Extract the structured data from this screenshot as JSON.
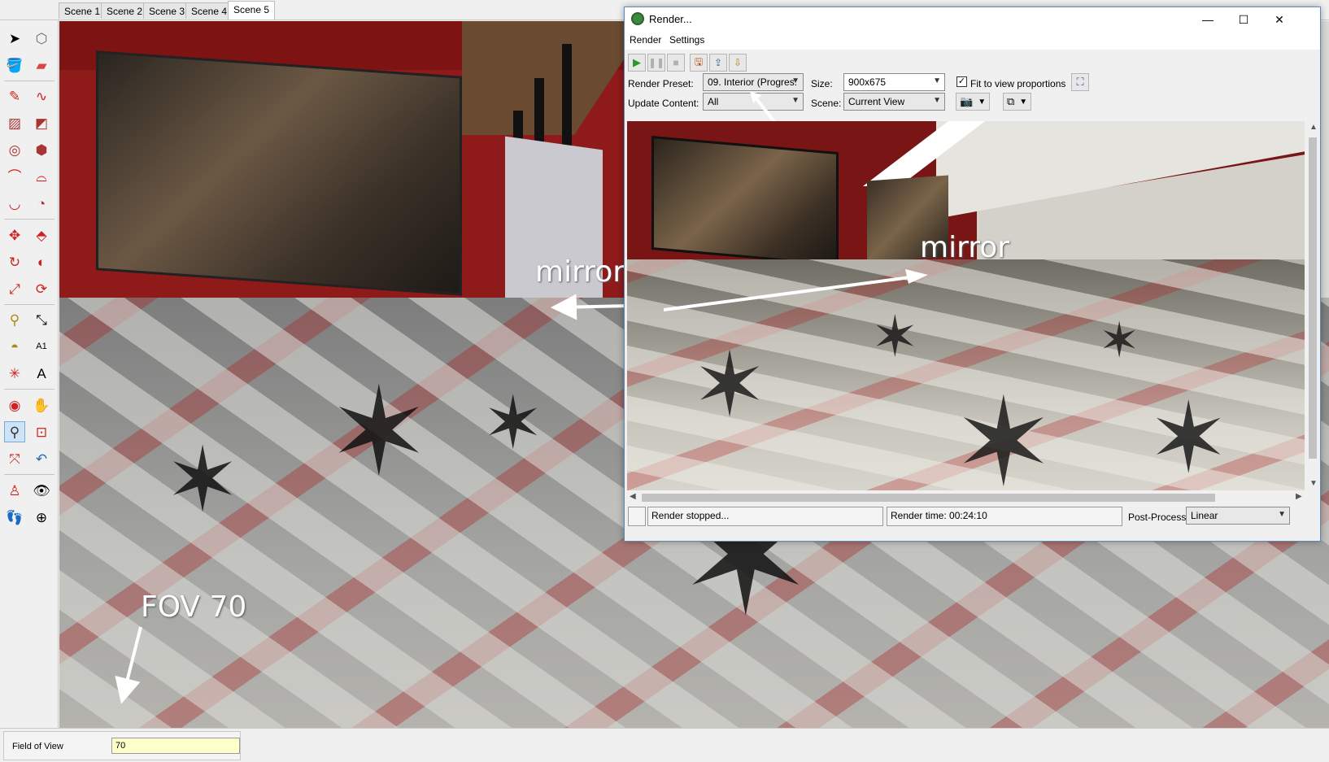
{
  "scene_tabs": [
    "Scene 1",
    "Scene 2",
    "Scene 3",
    "Scene 4",
    "Scene 5"
  ],
  "active_scene": "Scene 5",
  "tools": [
    "select-icon",
    "component-icon",
    "paint-bucket-icon",
    "eraser-icon",
    "line-icon",
    "freehand-icon",
    "rectangle-icon",
    "rotated-rectangle-icon",
    "circle-icon",
    "polygon-icon",
    "arc-icon",
    "two-point-arc-icon",
    "three-point-arc-icon",
    "pie-icon",
    "move-icon",
    "push-pull-icon",
    "rotate-icon",
    "follow-me-icon",
    "scale-icon",
    "offset-icon",
    "tape-measure-icon",
    "dimension-icon",
    "protractor-icon",
    "text-icon",
    "axes-icon",
    "3d-text-icon",
    "orbit-icon",
    "pan-icon",
    "zoom-icon",
    "zoom-window-icon",
    "zoom-extents-icon",
    "previous-view-icon",
    "position-camera-icon",
    "look-around-icon",
    "walk-icon",
    "section-plane-icon"
  ],
  "viewport": {
    "annotation_mirror": "mirror",
    "annotation_fov": "FOV 70"
  },
  "vcb": {
    "label": "Field of View",
    "value": "70"
  },
  "render_window": {
    "title": "Render...",
    "menu": [
      "Render",
      "Settings"
    ],
    "toolbar": [
      "play-icon",
      "pause-icon",
      "stop-icon",
      "save-image-icon",
      "export-icon",
      "import-icon"
    ],
    "render_preset_label": "Render Preset:",
    "render_preset_value": "09. Interior (Progres:",
    "size_label": "Size:",
    "size_value": "900x675",
    "fit_label": "Fit to view proportions",
    "fit_checked": true,
    "update_content_label": "Update Content:",
    "update_content_value": "All",
    "scene_label": "Scene:",
    "scene_value": "Current View",
    "render_annotation": "mirror",
    "status_text": "Render stopped...",
    "render_time": "Render time: 00:24:10",
    "post_process_label": "Post-Process:",
    "post_process_value": "Linear"
  }
}
